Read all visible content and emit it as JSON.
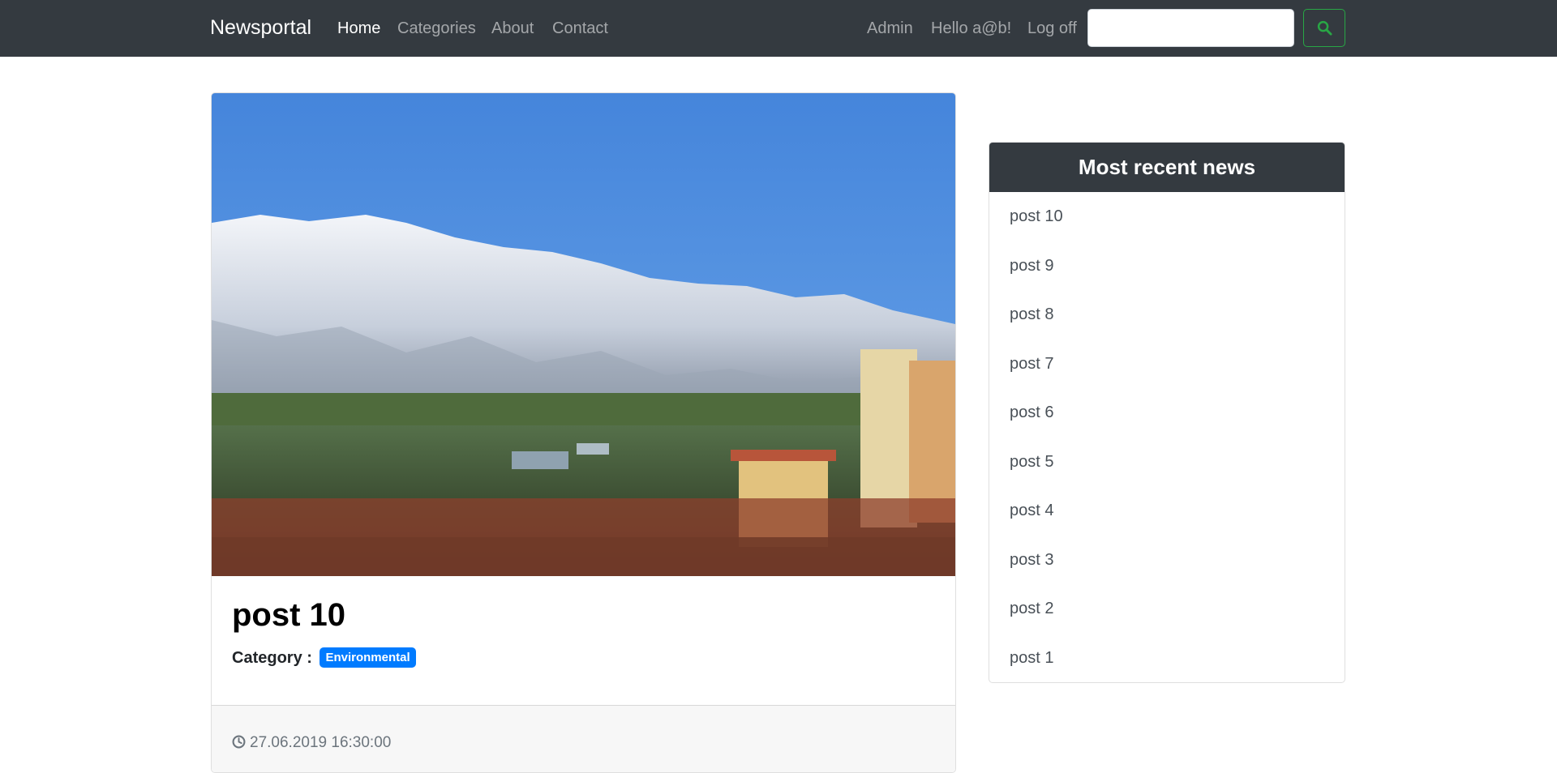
{
  "navbar": {
    "brand": "Newsportal",
    "links": [
      "Home",
      "Categories",
      "About",
      "Contact"
    ],
    "right_links": [
      "Admin",
      "Hello a@b!",
      "Log off"
    ],
    "search_placeholder": "",
    "search_icon": "search-icon",
    "background_color": "#343a40",
    "search_button_color": "#28a745"
  },
  "post": {
    "image_description": "snow-capped mountains above city",
    "title": "post 10",
    "category_label": "Category :",
    "category": "Environmental",
    "category_color": "#007bff",
    "timestamp": "27.06.2019 16:30:00",
    "timestamp_icon": "clock-icon"
  },
  "sidebar": {
    "title": "Most recent news",
    "items": [
      "post 10",
      "post 9",
      "post 8",
      "post 7",
      "post 6",
      "post 5",
      "post 4",
      "post 3",
      "post 2",
      "post 1"
    ]
  }
}
